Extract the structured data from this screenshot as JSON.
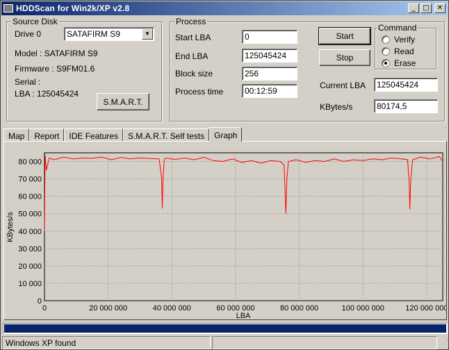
{
  "window": {
    "title": "HDDScan for Win2k/XP  v2.8"
  },
  "source_disk": {
    "legend": "Source Disk",
    "drive_label": "Drive  0",
    "drive_select": "SATAFIRM   S9",
    "model": "Model : SATAFIRM   S9",
    "firmware": "Firmware : S9FM01.6",
    "serial": "Serial :",
    "lba": "LBA :  125045424",
    "smart_button": "S.M.A.R.T."
  },
  "process": {
    "legend": "Process",
    "start_lba_label": "Start LBA",
    "start_lba": "0",
    "end_lba_label": "End LBA",
    "end_lba": "125045424",
    "block_size_label": "Block size",
    "block_size": "256",
    "process_time_label": "Process time",
    "process_time": "00:12:59",
    "start_button": "Start",
    "stop_button": "Stop",
    "current_lba_label": "Current LBA",
    "current_lba": "125045424",
    "kbytes_label": "KBytes/s",
    "kbytes": "80174,5"
  },
  "command": {
    "legend": "Command",
    "options": [
      "Verify",
      "Read",
      "Erase"
    ],
    "selected": "Erase"
  },
  "tabs": [
    "Map",
    "Report",
    "IDE Features",
    "S.M.A.R.T. Self tests",
    "Graph"
  ],
  "active_tab": "Graph",
  "chart_data": {
    "type": "line",
    "xlabel": "LBA",
    "ylabel": "KBytes/s",
    "xlim": [
      0,
      125045424
    ],
    "ylim": [
      0,
      85000
    ],
    "x_ticks": [
      0,
      20000000,
      40000000,
      60000000,
      80000000,
      100000000,
      120000000
    ],
    "x_tick_labels": [
      "0",
      "20 000 000",
      "40 000 000",
      "60 000 000",
      "80 000 000",
      "100 000 000",
      "120 000 000"
    ],
    "y_ticks": [
      0,
      10000,
      20000,
      30000,
      40000,
      50000,
      60000,
      70000,
      80000
    ],
    "y_tick_labels": [
      "0",
      "10 000",
      "20 000",
      "30 000",
      "40 000",
      "50 000",
      "60 000",
      "70 000",
      "80 000"
    ],
    "grid": true,
    "line_color": "#ff0000",
    "series": [
      {
        "x": [
          0,
          200000,
          600000,
          1500000,
          3000000,
          6000000,
          9000000,
          12000000,
          15000000,
          18000000,
          21000000,
          24000000,
          27000000,
          30000000,
          33000000,
          36000000,
          36800000,
          37000000,
          37200000,
          37600000,
          38000000,
          41000000,
          44000000,
          47000000,
          50000000,
          53000000,
          56000000,
          59000000,
          62000000,
          65000000,
          68000000,
          71000000,
          74000000,
          75200000,
          75500000,
          75800000,
          76100000,
          76600000,
          79000000,
          82000000,
          85000000,
          88000000,
          91000000,
          94000000,
          97000000,
          100000000,
          103000000,
          106000000,
          109000000,
          112000000,
          114000000,
          114500000,
          114700000,
          115000000,
          115600000,
          118000000,
          121000000,
          124000000,
          125045424
        ],
        "y": [
          40000,
          83500,
          75000,
          82000,
          81000,
          82500,
          81500,
          82000,
          81800,
          82500,
          81000,
          82300,
          81500,
          82000,
          81700,
          81500,
          70000,
          53000,
          70000,
          81000,
          82000,
          81200,
          82000,
          81000,
          82400,
          80500,
          80000,
          81500,
          79500,
          80500,
          79000,
          80500,
          80000,
          78000,
          65000,
          50000,
          70000,
          80000,
          81000,
          79500,
          80500,
          80000,
          81500,
          80000,
          81000,
          80500,
          81500,
          81000,
          82000,
          81500,
          81000,
          68000,
          52500,
          70000,
          81000,
          82500,
          81500,
          82800,
          80000
        ]
      }
    ]
  },
  "status": {
    "message": "Windows XP found",
    "panel2": "",
    "progress_percent": 100
  }
}
